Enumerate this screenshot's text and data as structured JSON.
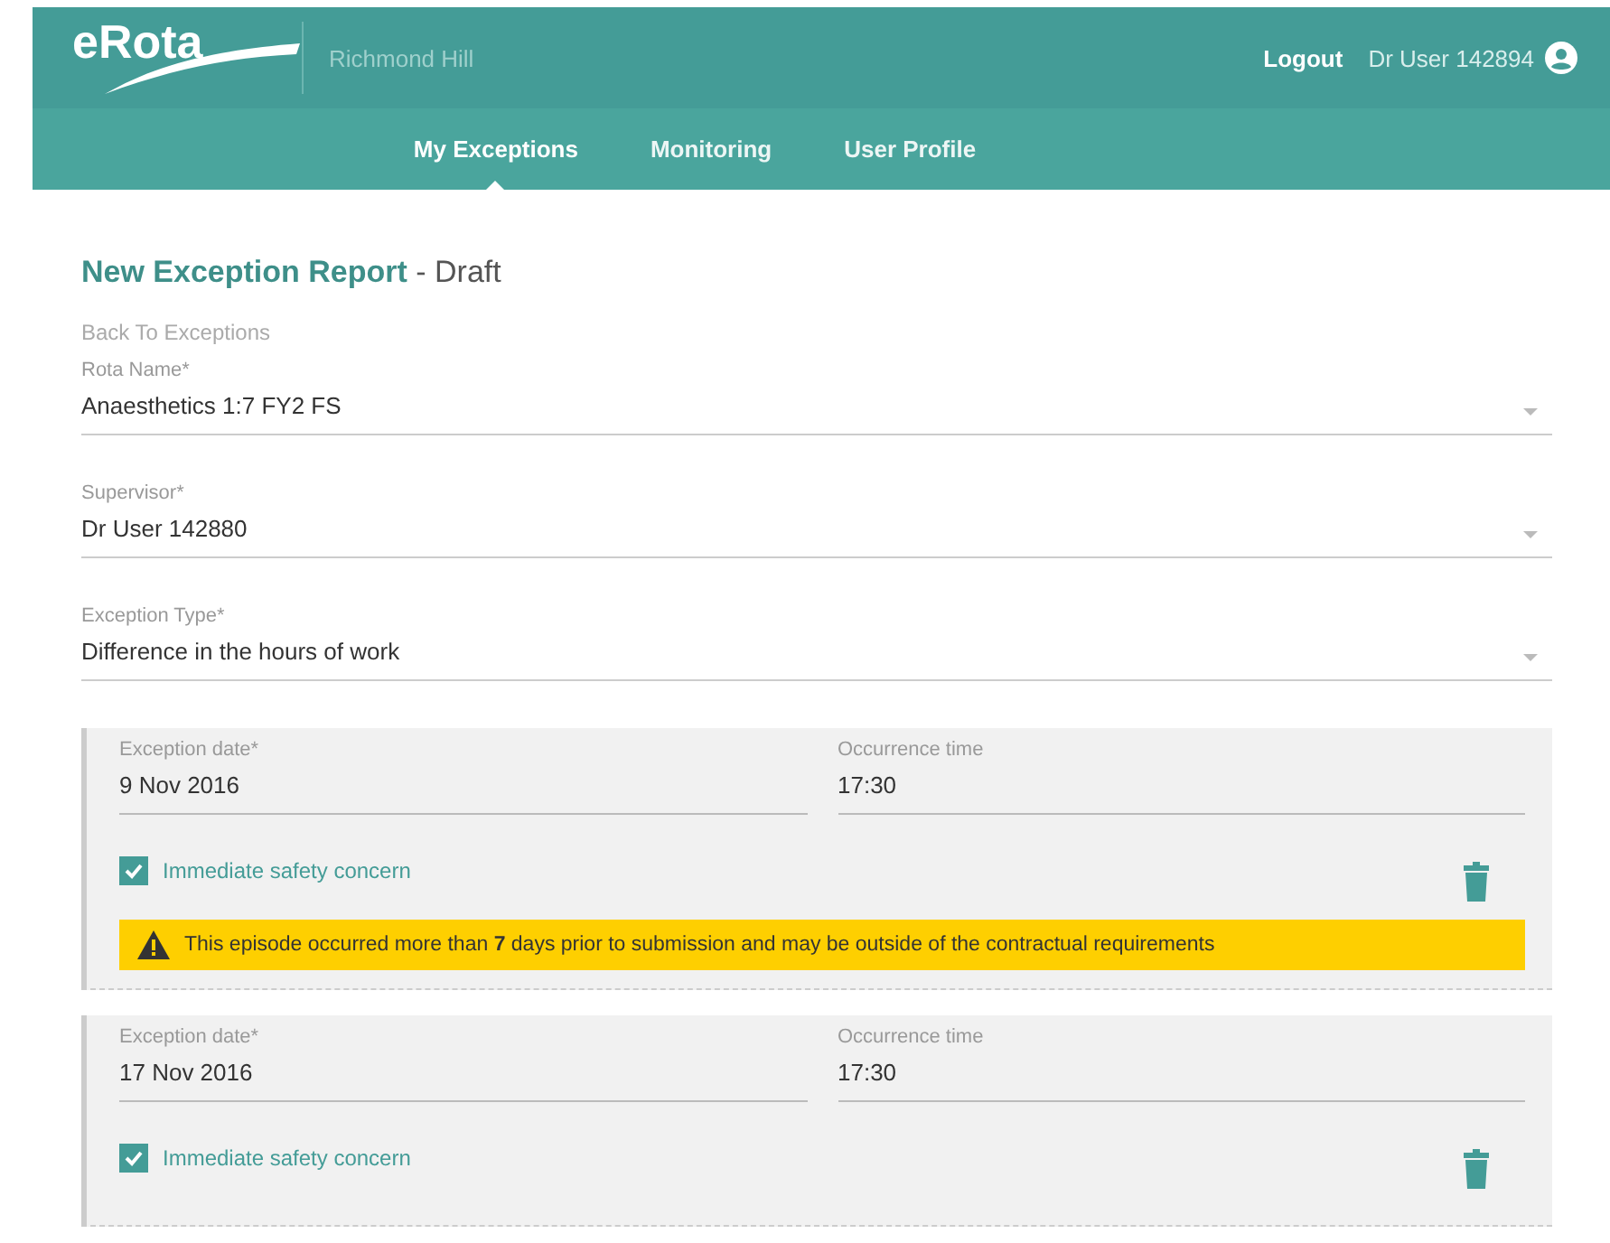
{
  "header": {
    "logo": "eRota",
    "site": "Richmond Hill",
    "logout": "Logout",
    "user": "Dr User 142894"
  },
  "nav": [
    {
      "label": "My Exceptions",
      "selected": true
    },
    {
      "label": "Monitoring",
      "selected": false
    },
    {
      "label": "User Profile",
      "selected": false
    }
  ],
  "title": {
    "main": "New Exception Report",
    "status": "- Draft"
  },
  "back_link": "Back To Exceptions",
  "selects": [
    {
      "label": "Rota Name*",
      "value": "Anaesthetics 1:7 FY2 FS"
    },
    {
      "label": "Supervisor*",
      "value": "Dr User 142880"
    },
    {
      "label": "Exception Type*",
      "value": "Difference in the hours of work"
    }
  ],
  "exceptions": [
    {
      "date_label": "Exception date*",
      "date": "9 Nov 2016",
      "time_label": "Occurrence time",
      "time": "17:30",
      "safety_label": "Immediate safety concern",
      "checked": true,
      "warning": "This episode occurred more than **7** days prior to submission and may be outside of the contractual requirements"
    },
    {
      "date_label": "Exception date*",
      "date": "17 Nov 2016",
      "time_label": "Occurrence time",
      "time": "17:30",
      "safety_label": "Immediate safety concern",
      "checked": true
    }
  ]
}
